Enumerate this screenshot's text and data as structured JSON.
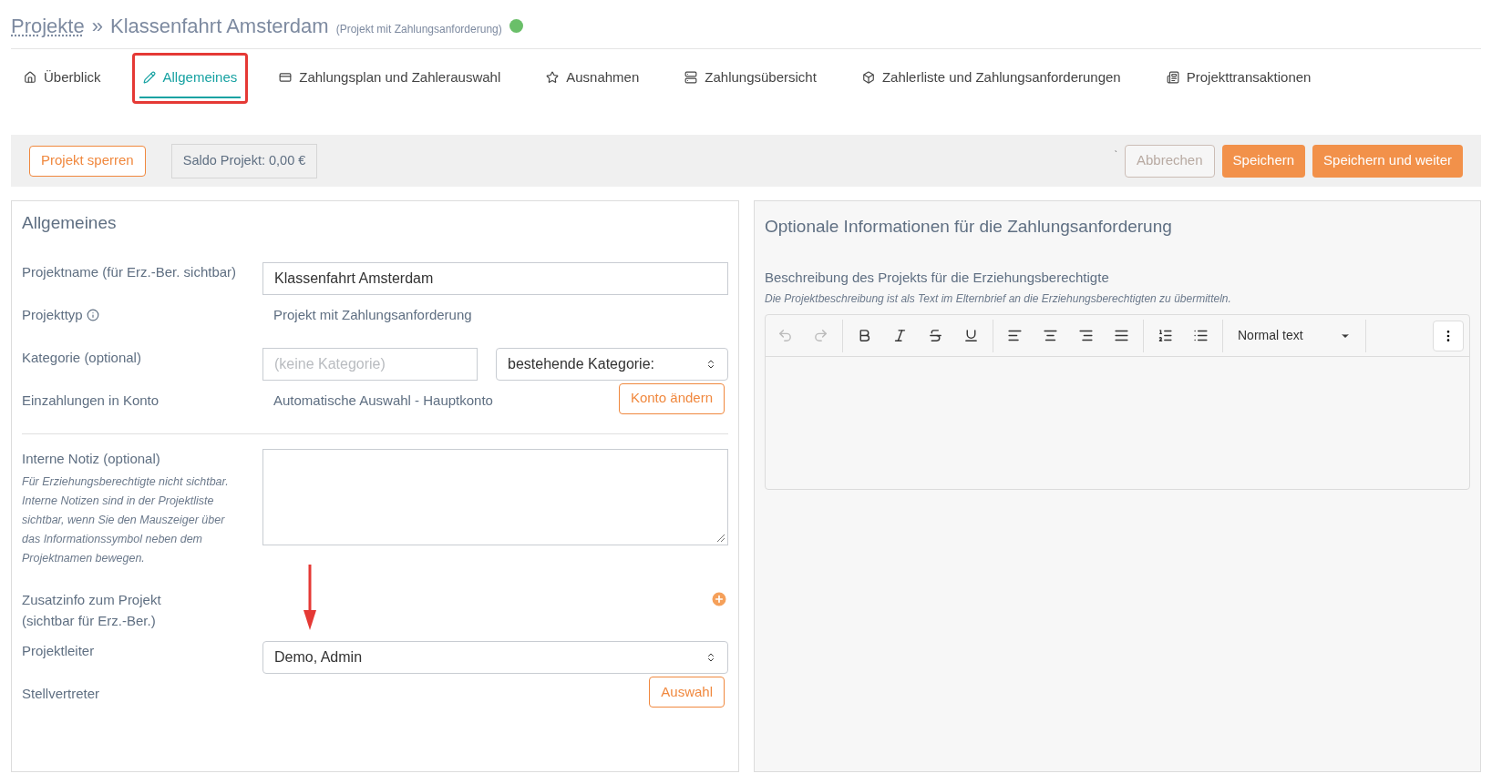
{
  "header": {
    "breadcrumb": "Projekte",
    "separator": "»",
    "title": "Klassenfahrt Amsterdam",
    "subtitle": "(Projekt mit Zahlungsanforderung)",
    "status_active": true
  },
  "tabs": [
    {
      "label": "Überblick",
      "selected": false
    },
    {
      "label": "Allgemeines",
      "selected": true
    },
    {
      "label": "Zahlungsplan und Zahlerauswahl",
      "selected": false
    },
    {
      "label": "Ausnahmen",
      "selected": false
    },
    {
      "label": "Zahlungsübersicht",
      "selected": false
    },
    {
      "label": "Zahlerliste und Zahlungsanforderungen",
      "selected": false
    },
    {
      "label": "Projekttransaktionen",
      "selected": false
    }
  ],
  "action_bar": {
    "lock_button": "Projekt sperren",
    "balance": "Saldo Projekt: 0,00 €",
    "stray_mark": "`",
    "cancel_button": "Abbrechen",
    "cancel_disabled": true,
    "save_button": "Speichern",
    "save_next_button": "Speichern und weiter"
  },
  "general": {
    "title": "Allgemeines",
    "rows": [
      {
        "kind": "input",
        "label": "Projektname (für Erz.-Ber. sichtbar)",
        "value": "Klassenfahrt Amsterdam"
      },
      {
        "kind": "text",
        "label": "Projekttyp",
        "info": true,
        "value": "Projekt mit Zahlungsanforderung"
      },
      {
        "kind": "category",
        "label": "Kategorie (optional)",
        "placeholder": "(keine Kategorie)",
        "select": "bestehende Kategorie:"
      },
      {
        "kind": "text_button",
        "label": "Einzahlungen in Konto",
        "value": "Automatische Auswahl - Hauptkonto",
        "button": "Konto ändern"
      },
      {
        "kind": "textarea",
        "label": "Interne Notiz (optional)",
        "hint": "Für Erziehungsberechtigte nicht sichtbar. Interne Notizen sind in der Projektliste sichtbar, wenn Sie den Mauszeiger über das Informationssymbol neben dem Projektnamen bewegen."
      },
      {
        "kind": "add",
        "label": "Zusatzinfo zum Projekt",
        "label_2": "(sichtbar für Erz.-Ber.)"
      },
      {
        "kind": "select",
        "label": "Projektleiter",
        "value": "Demo, Admin"
      },
      {
        "kind": "button",
        "label": "Stellvertreter",
        "button": "Auswahl"
      }
    ]
  },
  "optional": {
    "title": "Optionale Informationen für die Zahlungsanforderung",
    "field_label": "Beschreibung des Projekts für die Erziehungsberechtigte",
    "hint": "Die Projektbeschreibung ist als Text im Elternbrief an die Erziehungsberechtigten zu übermitteln.",
    "undo_disabled": true,
    "redo_disabled": true,
    "style_select": "Normal text"
  }
}
